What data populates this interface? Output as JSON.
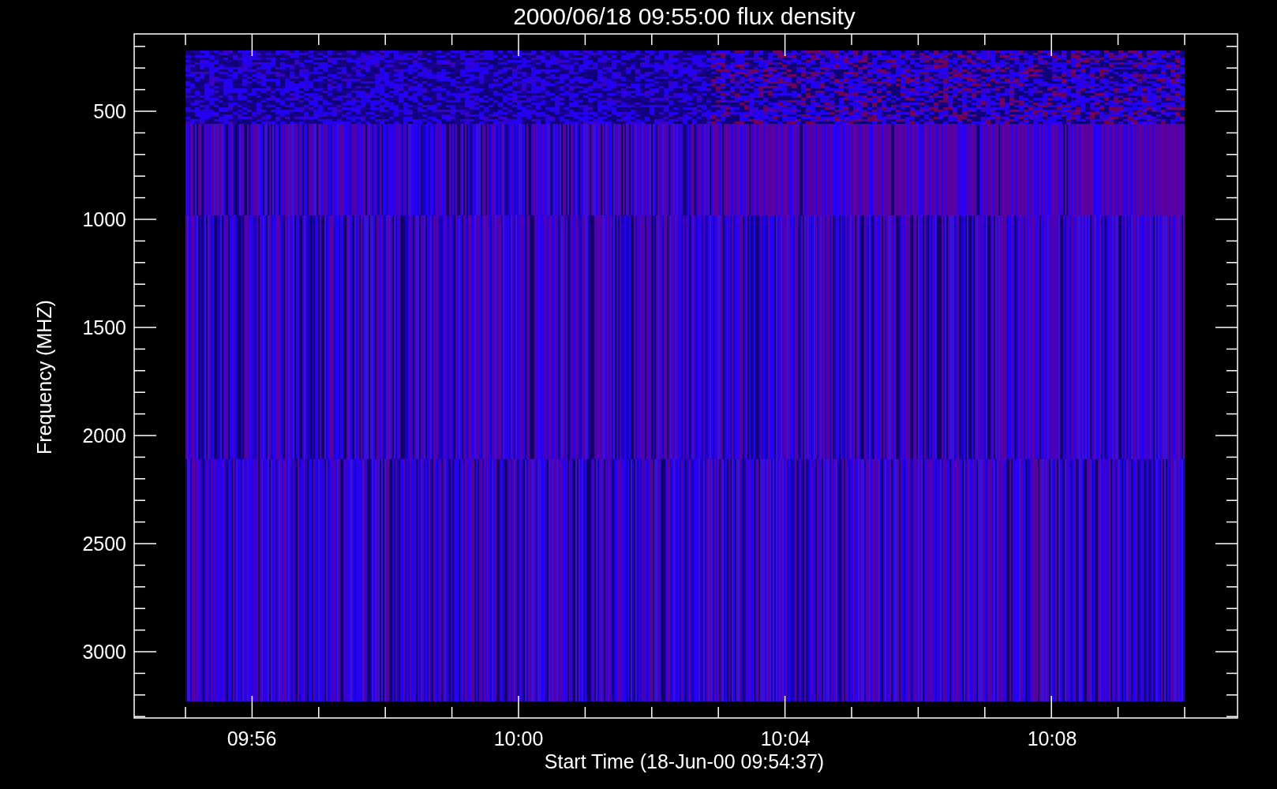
{
  "title": "2000/06/18 09:55:00 flux density",
  "y_axis": {
    "label": "Frequency (MHZ)",
    "ticks": [
      "500",
      "1000",
      "1500",
      "2000",
      "2500",
      "3000"
    ]
  },
  "x_axis": {
    "label": "Start Time (18-Jun-00 09:54:37)",
    "ticks": [
      "09:56",
      "10:00",
      "10:04",
      "10:08"
    ]
  }
}
